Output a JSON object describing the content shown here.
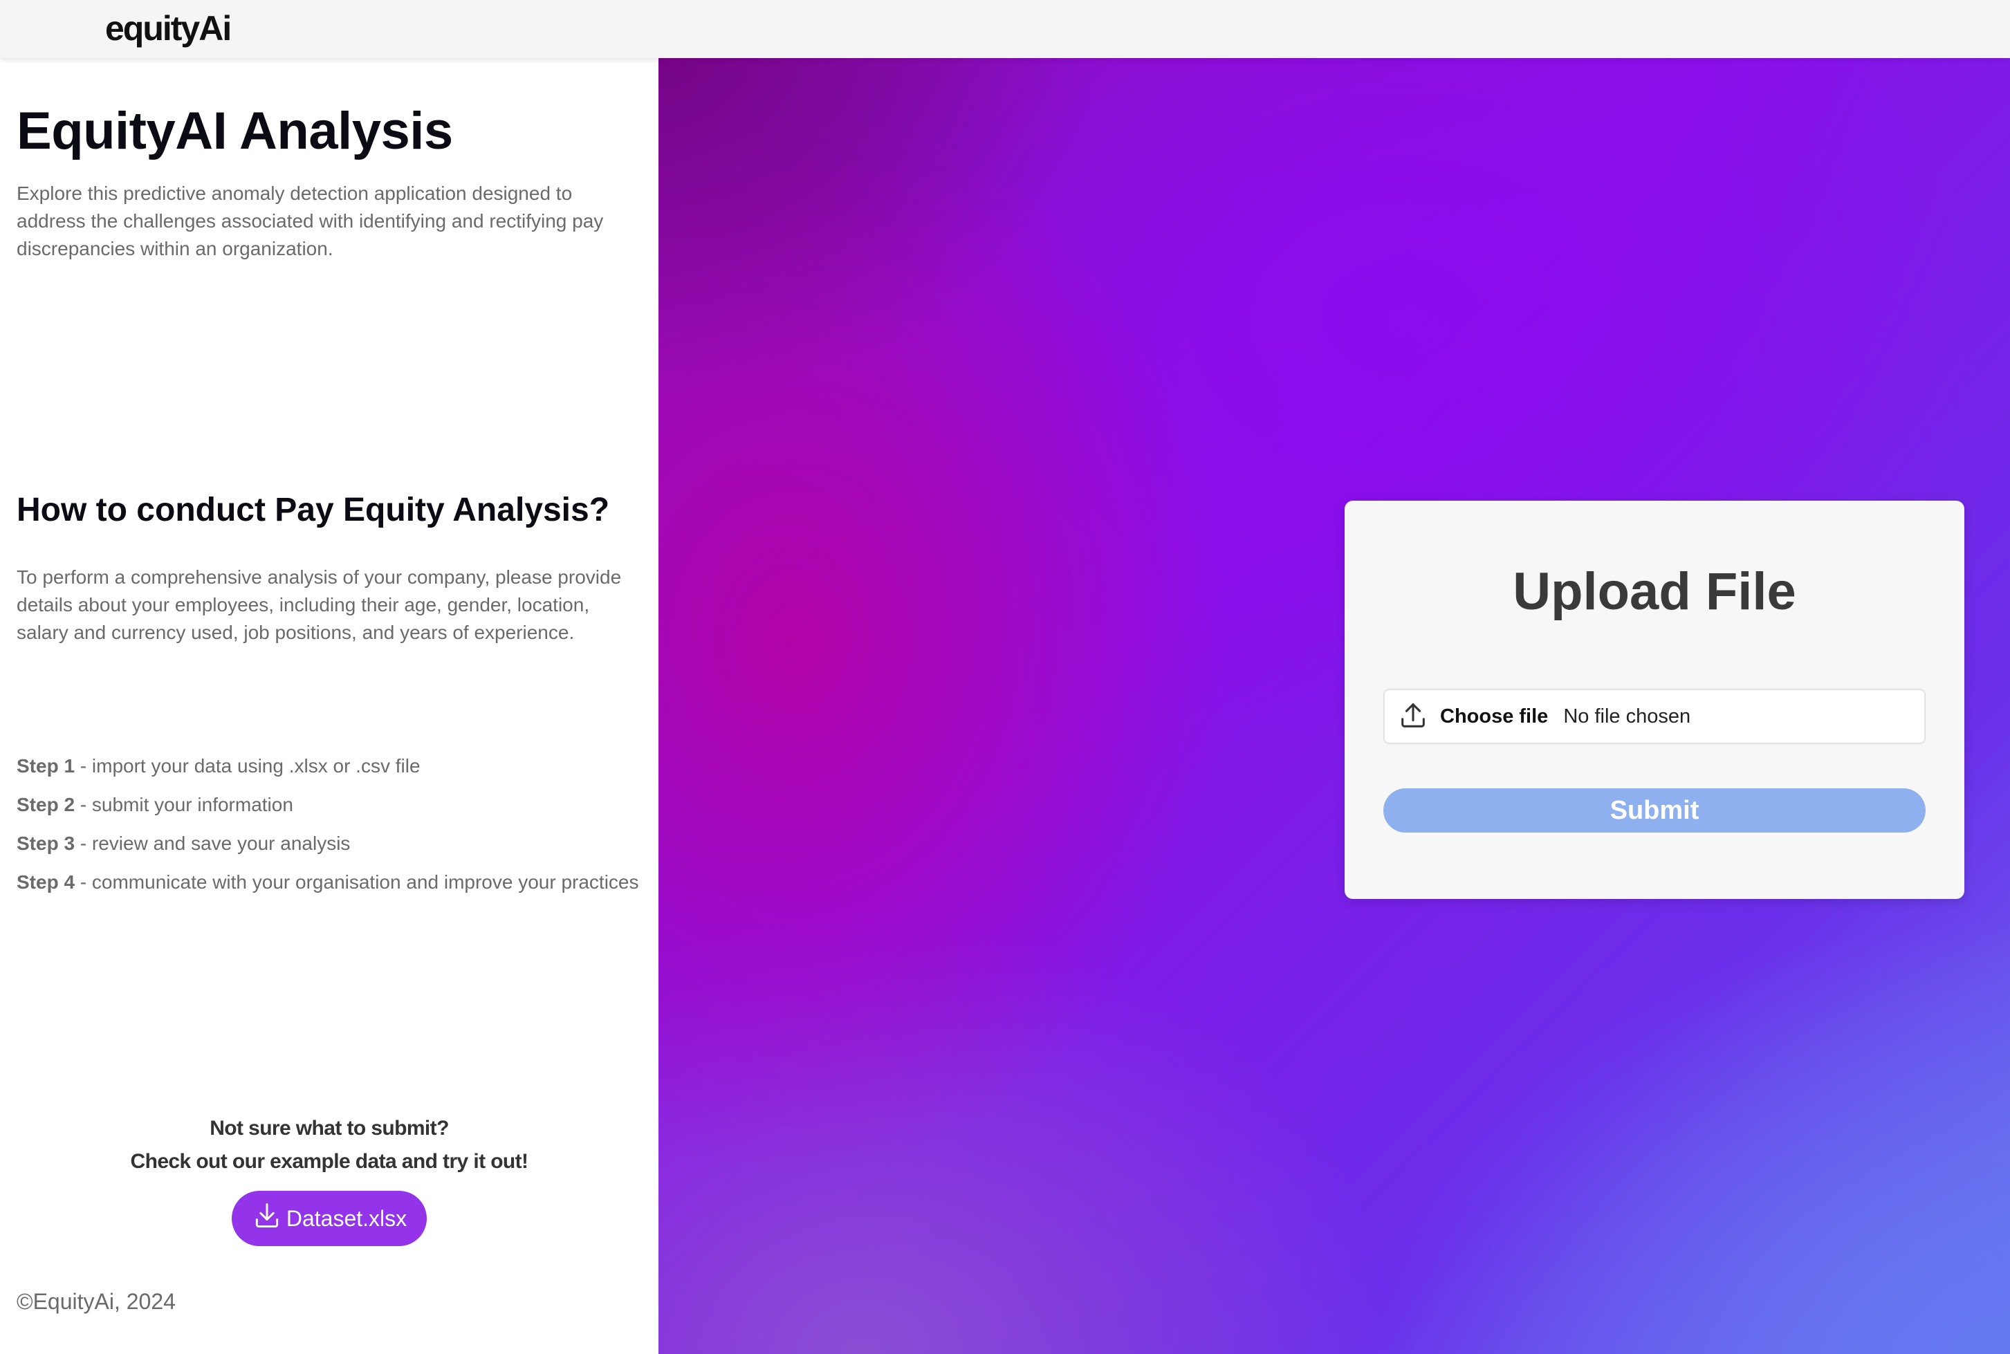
{
  "header": {
    "brand": "equityAi"
  },
  "intro": {
    "title": "EquityAI Analysis",
    "description": "Explore this predictive anomaly detection application designed to address the challenges associated with identifying and rectifying pay discrepancies within an organization."
  },
  "howto": {
    "title": "How to conduct Pay Equity Analysis?",
    "description": "To perform a comprehensive analysis of your company, please provide details about your employees, including their age, gender, location, salary and currency used, job positions, and years of experience.",
    "steps": [
      {
        "label": "Step 1",
        "text": " - import your data using .xlsx or .csv file"
      },
      {
        "label": "Step 2",
        "text": " - submit your information"
      },
      {
        "label": "Step 3",
        "text": " - review and save your analysis"
      },
      {
        "label": "Step 4",
        "text": " - communicate with your organisation and improve your practices"
      }
    ]
  },
  "example": {
    "line1": "Not sure what to submit?",
    "line2": "Check out our example data and try it out!",
    "button_label": "Dataset.xlsx",
    "icon": "download-icon"
  },
  "footer": {
    "copyright": "©EquityAi, 2024"
  },
  "upload": {
    "title": "Upload File",
    "choose_label": "Choose file",
    "file_status": "No file chosen",
    "icon": "upload-icon",
    "submit_label": "Submit"
  },
  "colors": {
    "accent_purple": "#9333ea",
    "submit_disabled": "#8fb0ef",
    "topbar_bg": "#f5f5f5"
  }
}
